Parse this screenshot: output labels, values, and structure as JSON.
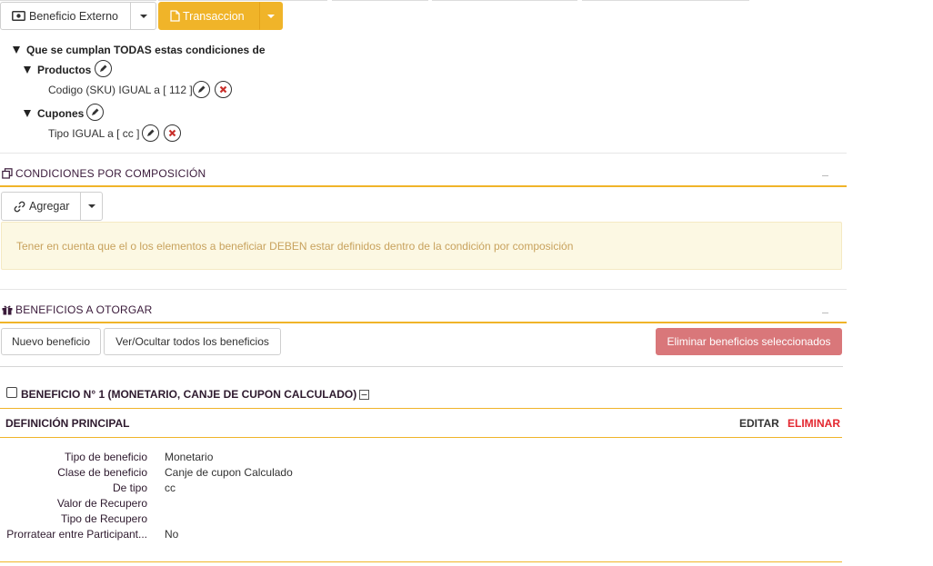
{
  "toolbar": {
    "beneficio_externo_label": "Beneficio Externo",
    "transaccion_label": "Transaccion"
  },
  "conditions": {
    "root_label": "Que se cumplan TODAS estas condiciones de",
    "groups": [
      {
        "label": "Productos",
        "item": "Codigo (SKU) IGUAL a [ 112 ]"
      },
      {
        "label": "Cupones",
        "item": "Tipo IGUAL a [ cc ]"
      }
    ]
  },
  "composition": {
    "title": "CONDICIONES POR COMPOSICIÓN",
    "add_label": "Agregar",
    "notice": "Tener en cuenta que el o los elementos a beneficiar DEBEN estar definidos dentro de la condición por composición"
  },
  "benefits": {
    "title": "BENEFICIOS A OTORGAR",
    "new_label": "Nuevo beneficio",
    "toggle_all_label": "Ver/Ocultar todos los beneficios",
    "delete_selected_label": "Eliminar beneficios seleccionados",
    "item": {
      "title": "BENEFICIO N° 1 (MONETARIO, CANJE DE CUPON CALCULADO)",
      "section_title": "DEFINICIÓN PRINCIPAL",
      "edit_label": "EDITAR",
      "delete_label": "ELIMINAR",
      "fields": [
        {
          "label": "Tipo de beneficio",
          "value": "Monetario"
        },
        {
          "label": "Clase de beneficio",
          "value": "Canje de cupon Calculado"
        },
        {
          "label": "De tipo",
          "value": "cc"
        },
        {
          "label": "Valor de Recupero",
          "value": ""
        },
        {
          "label": "Tipo de Recupero",
          "value": ""
        },
        {
          "label": "Prorratear entre Participant...",
          "value": "No"
        }
      ]
    }
  },
  "colors": {
    "accent": "#f0b429",
    "danger": "#d9534f",
    "danger_button": "#d9777a",
    "notice_bg": "#fcf8e3"
  }
}
